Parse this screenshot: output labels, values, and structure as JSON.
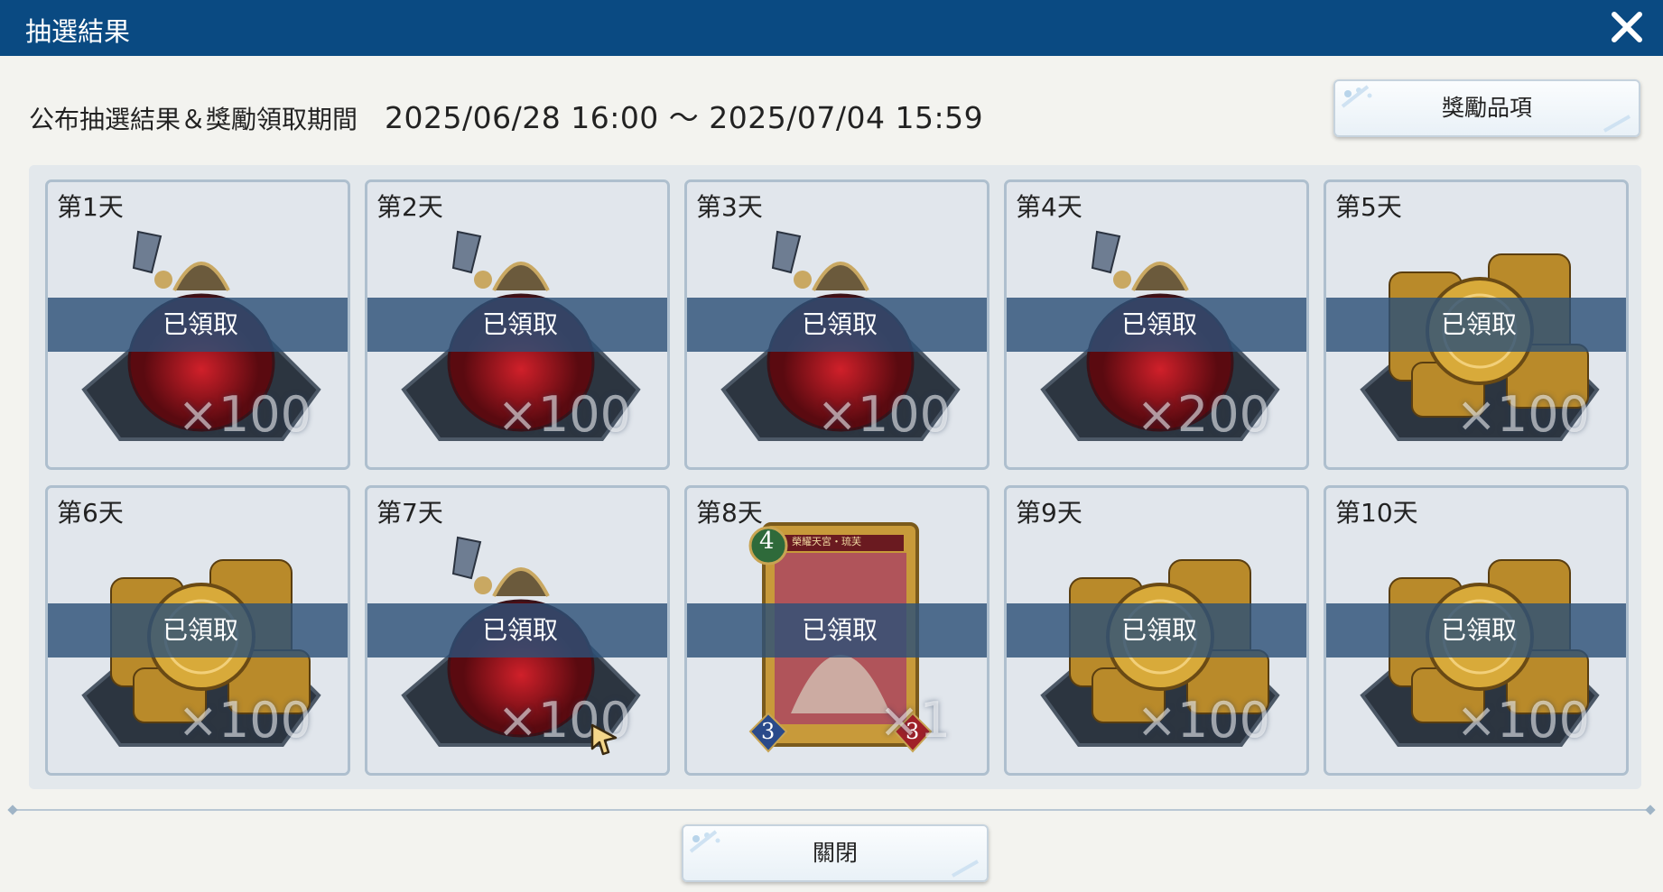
{
  "window": {
    "title": "抽選結果"
  },
  "header": {
    "period_label": "公布抽選結果＆獎勵領取期間",
    "period_dates": "2025/06/28 16:00 ～ 2025/07/04 15:59",
    "rewards_button": "獎勵品項"
  },
  "cards": [
    {
      "day": "第1天",
      "item": "potion",
      "qty": "×100",
      "status": "已領取"
    },
    {
      "day": "第2天",
      "item": "potion",
      "qty": "×100",
      "status": "已領取"
    },
    {
      "day": "第3天",
      "item": "potion",
      "qty": "×100",
      "status": "已領取"
    },
    {
      "day": "第4天",
      "item": "potion",
      "qty": "×200",
      "status": "已領取"
    },
    {
      "day": "第5天",
      "item": "coins",
      "qty": "×100",
      "status": "已領取"
    },
    {
      "day": "第6天",
      "item": "coins",
      "qty": "×100",
      "status": "已領取"
    },
    {
      "day": "第7天",
      "item": "potion",
      "qty": "×100",
      "status": "已領取"
    },
    {
      "day": "第8天",
      "item": "card",
      "qty": "×1",
      "status": "已領取",
      "card_cost": "4",
      "card_atk": "3",
      "card_hp": "3",
      "card_name": "榮耀天宮・琉芙"
    },
    {
      "day": "第9天",
      "item": "coins",
      "qty": "×100",
      "status": "已領取"
    },
    {
      "day": "第10天",
      "item": "coins",
      "qty": "×100",
      "status": "已領取"
    }
  ],
  "footer": {
    "close_button": "關閉"
  },
  "colors": {
    "titlebar": "#0a4a82",
    "band": "#2d5078",
    "card_border": "#aebfce"
  }
}
